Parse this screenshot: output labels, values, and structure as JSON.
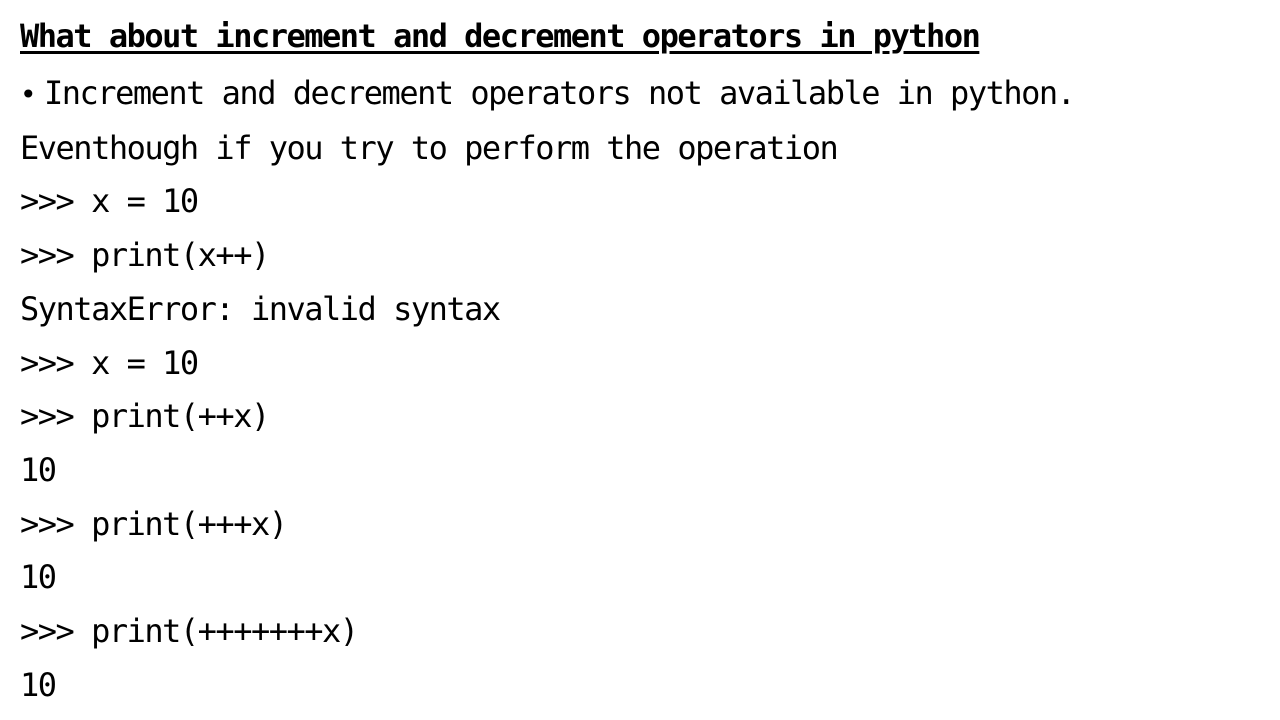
{
  "slide": {
    "title": "What about increment and decrement operators in python",
    "bullet": "Increment and decrement operators not available in python.",
    "lines": [
      "Eventhough if you try to perform the operation",
      ">>> x = 10",
      ">>> print(x++)",
      "SyntaxError: invalid syntax",
      ">>> x = 10",
      ">>> print(++x)",
      "10",
      ">>> print(+++x)",
      "10",
      ">>> print(+++++++x)",
      "10"
    ]
  }
}
